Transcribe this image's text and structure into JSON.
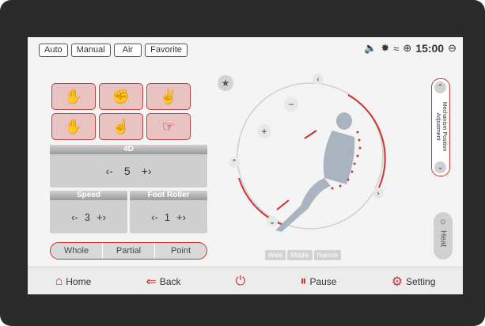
{
  "top_bar": {
    "modes": [
      "Auto",
      "Manual",
      "Air",
      "Favorite"
    ],
    "status": {
      "volume_icon": "speaker-icon",
      "bluetooth_icon": "bluetooth-icon",
      "wifi_icon": "wifi-icon",
      "add_icon": "plus-circle-icon",
      "time": "15:00",
      "minus_icon": "minus-circle-icon"
    }
  },
  "panels": {
    "p4d": {
      "title": "4D",
      "value": "5",
      "left": "‹-",
      "right": "+›"
    },
    "speed": {
      "title": "Speed",
      "value": "3",
      "left": "‹-",
      "right": "+›"
    },
    "foot": {
      "title": "Foot Roller",
      "value": "1",
      "left": "‹-",
      "right": "+›"
    }
  },
  "bar": [
    "Whole",
    "Partial",
    "Point"
  ],
  "widths": [
    "Wide",
    "Middle",
    "Narrow"
  ],
  "side": {
    "mechanism_label": "Mechanism Position Adjustment",
    "heat_label": "Heat"
  },
  "bottom": {
    "home": "Home",
    "back": "Back",
    "pause": "Pause",
    "setting": "Setting"
  },
  "colors": {
    "accent": "#cc3333",
    "chip": "#d2d2d2"
  },
  "icons": [
    "rubbing-icon",
    "tapping-icon",
    "kneading-icon",
    "knocking-icon",
    "pressing-icon",
    "shiatsu-icon"
  ]
}
